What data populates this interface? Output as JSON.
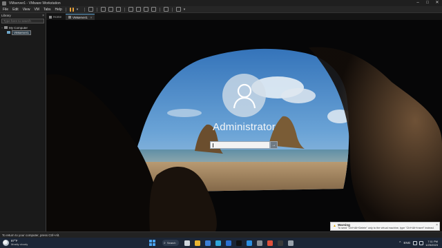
{
  "window": {
    "title": "VMserver1 - VMware Workstation",
    "min_glyph": "–",
    "max_glyph": "□",
    "close_glyph": "✕"
  },
  "menu": [
    "File",
    "Edit",
    "View",
    "VM",
    "Tabs",
    "Help"
  ],
  "toolbar": {
    "buttons": [
      "pause-icon",
      "send-keys-icon",
      "snapshot-icon",
      "revert-snapshot-icon",
      "manage-snapshots-icon",
      "library-toggle-icon",
      "thumbnail-bar-icon",
      "fullscreen-icon",
      "unity-icon",
      "console-view-icon",
      "stretch-icon"
    ],
    "caret": "▾"
  },
  "library": {
    "title": "Library",
    "close_glyph": "×",
    "search_placeholder": "Type here to search",
    "search_caret": "▾",
    "tree_toggle": "−",
    "root_label": "My Computer",
    "vm_label": "VMserver1"
  },
  "tabs": [
    {
      "label": "Home",
      "active": false,
      "close": ""
    },
    {
      "label": "VMserver1",
      "active": true,
      "close": "×"
    }
  ],
  "vm": {
    "username": "Administrator",
    "password_value": "",
    "submit_glyph": "→",
    "screen_icons": {
      "network": "⊡",
      "power": "⏻"
    }
  },
  "status": {
    "text": "To return to your computer, press Ctrl+Alt."
  },
  "warning": {
    "icon_glyph": "▲",
    "title": "Warning",
    "body": "To send \"Ctrl+Alt+Delete\" only to the virtual machine, type \"Ctrl+Alt+Insert\" instead.",
    "close_glyph": "×"
  },
  "taskbar": {
    "weather_temp": "87°F",
    "weather_desc": "Mostly cloudy",
    "search_label": "Search",
    "search_glyph": "⌕",
    "apps": [
      {
        "name": "task-view-icon",
        "color": "#cfd6dd"
      },
      {
        "name": "file-explorer-icon",
        "color": "#e8b431"
      },
      {
        "name": "mail-icon",
        "color": "#3c7fd6"
      },
      {
        "name": "edge-icon",
        "color": "#2fa4d9"
      },
      {
        "name": "store-icon",
        "color": "#2c6fcf"
      },
      {
        "name": "tiktok-icon",
        "color": "#111111"
      },
      {
        "name": "vscode-icon",
        "color": "#2b8fe2"
      },
      {
        "name": "settings-icon",
        "color": "#8a8f96"
      },
      {
        "name": "chrome-icon",
        "color": "#e0503b"
      },
      {
        "name": "terminal-icon",
        "color": "#3a3a3a"
      },
      {
        "name": "vmware-icon",
        "color": "#9aa2ab"
      }
    ],
    "tray_chevron": "^",
    "language": "ENG",
    "time": "7:11 PM",
    "date": "1/25/2023"
  }
}
